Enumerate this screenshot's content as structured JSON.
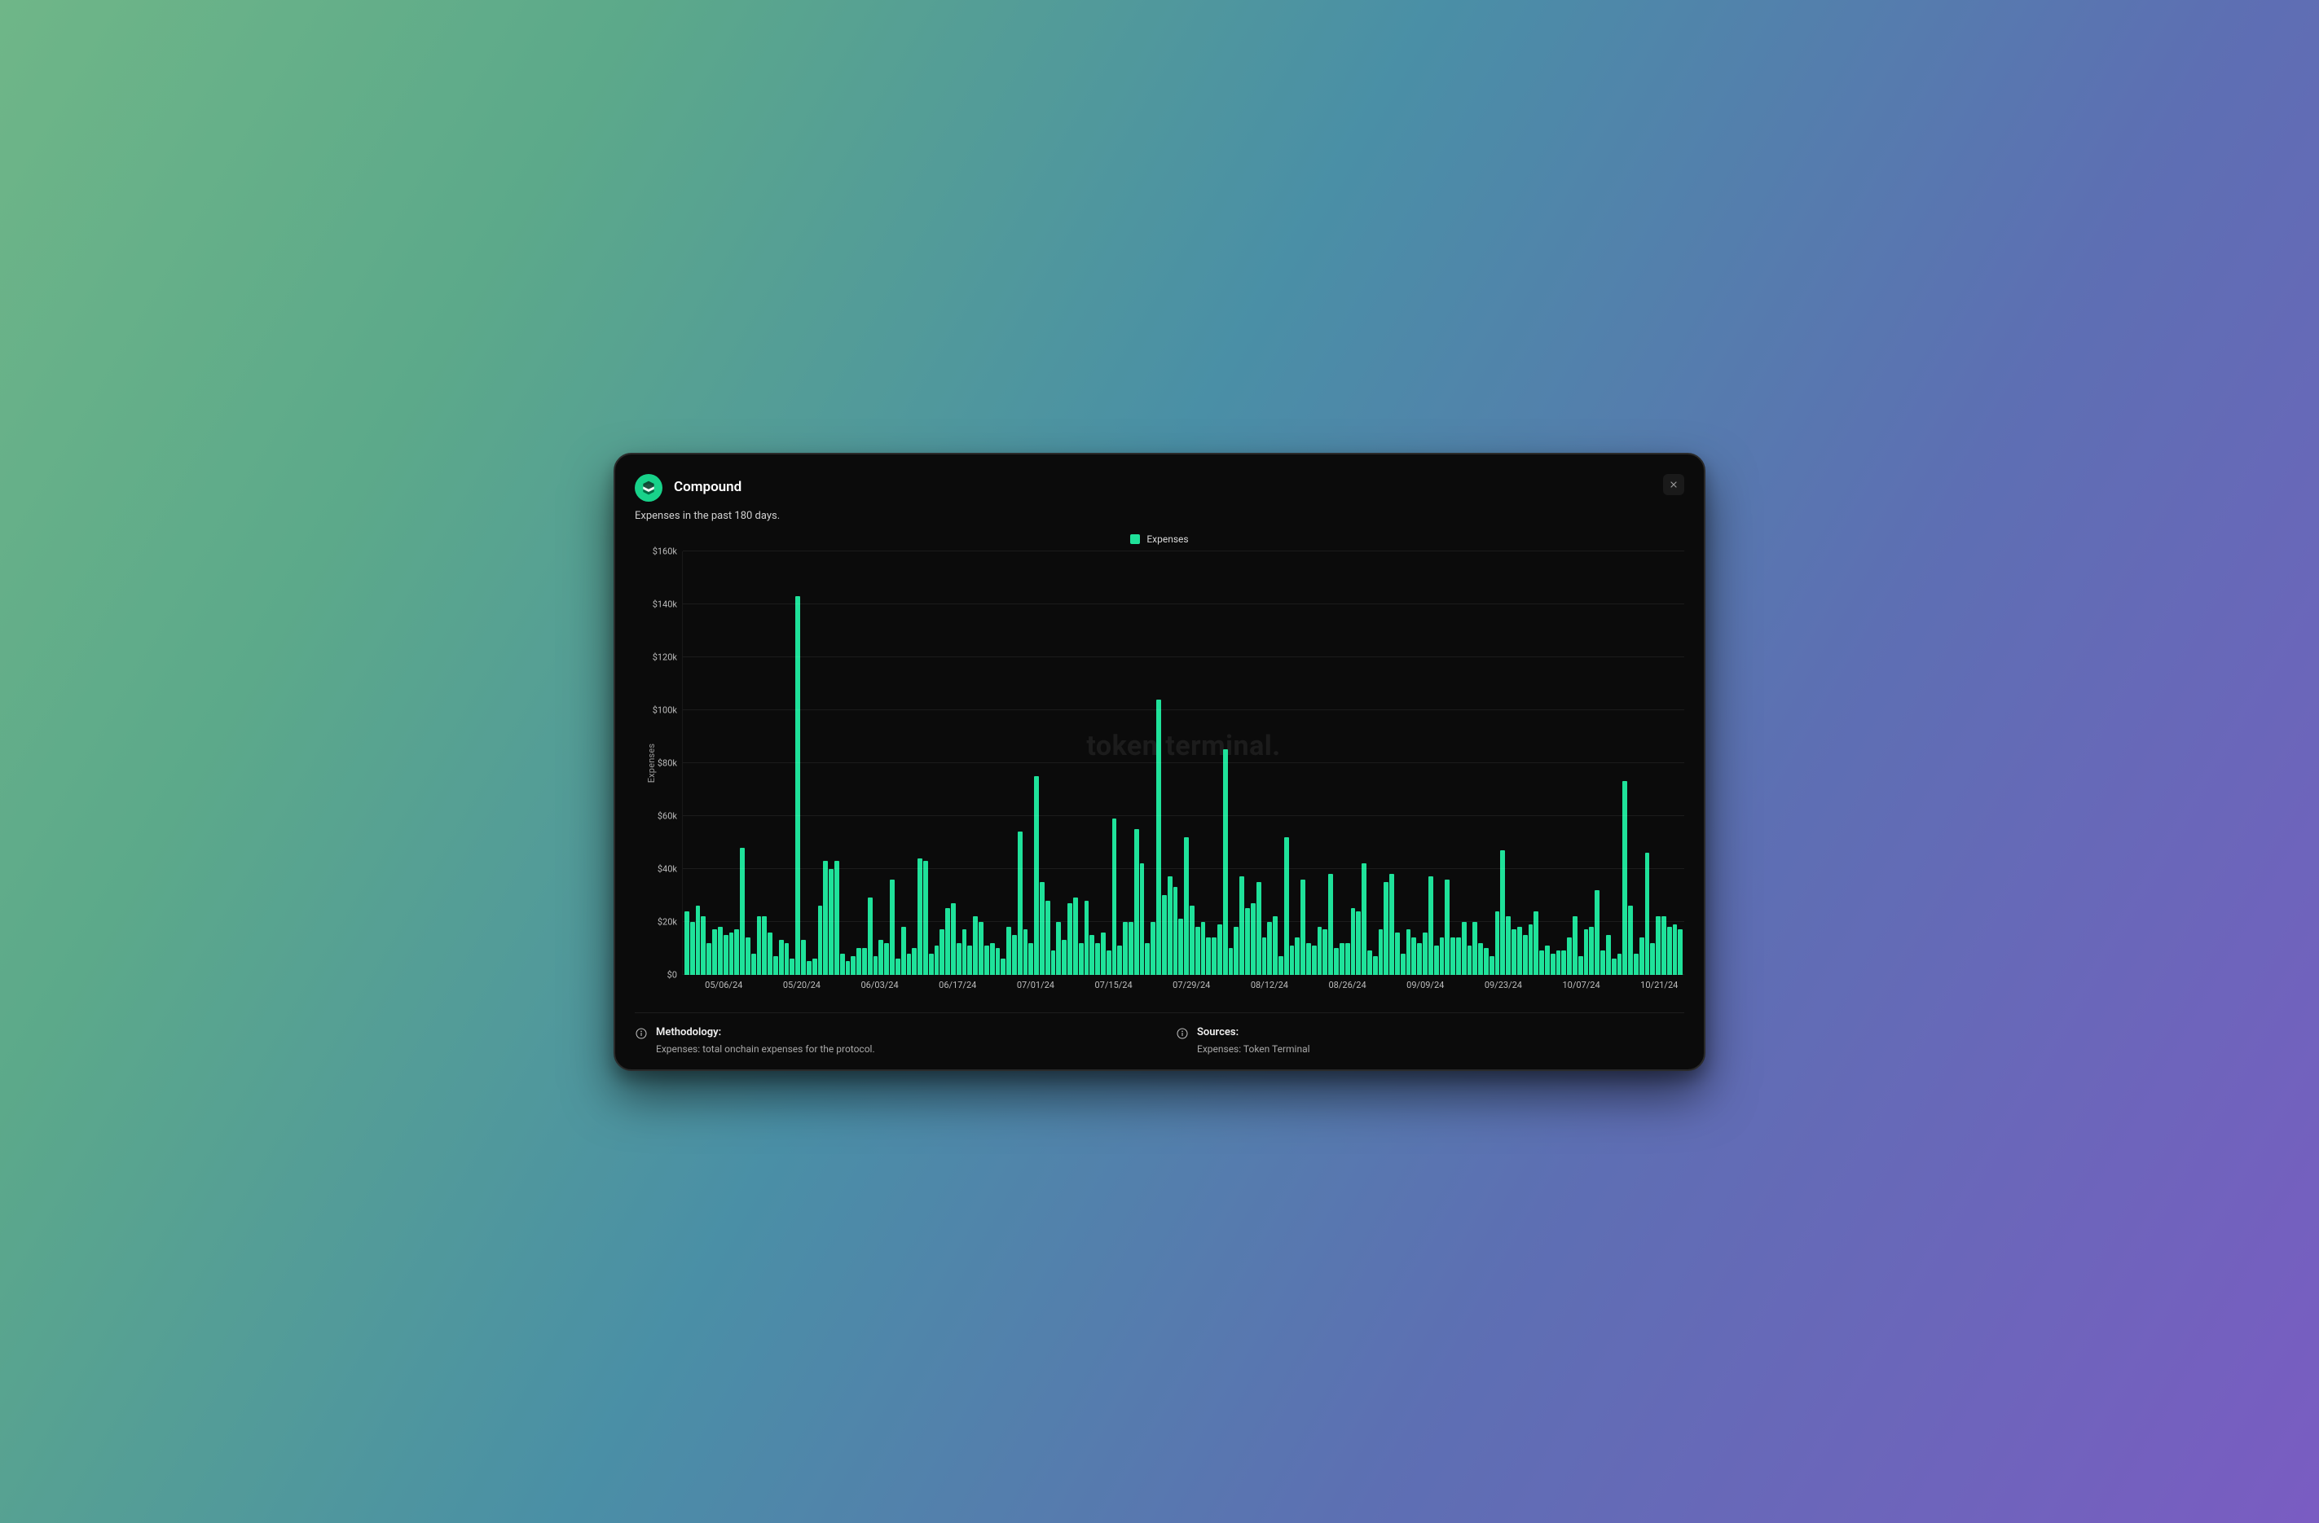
{
  "header": {
    "title": "Compound",
    "subtitle": "Expenses in the past 180 days."
  },
  "legend": {
    "label": "Expenses",
    "color": "#1fe29a"
  },
  "watermark": "token terminal.",
  "ylabel": "Expenses",
  "footer": {
    "methodology_title": "Methodology:",
    "methodology_text": "Expenses: total onchain expenses for the protocol.",
    "sources_title": "Sources:",
    "sources_text": "Expenses: Token Terminal"
  },
  "chart_data": {
    "type": "bar",
    "title": "Compound — Expenses in the past 180 days",
    "xlabel": "",
    "ylabel": "Expenses",
    "ylim": [
      0,
      160000
    ],
    "y_ticks": [
      0,
      20000,
      40000,
      60000,
      80000,
      100000,
      120000,
      140000,
      160000
    ],
    "y_tick_labels": [
      "$0",
      "$20k",
      "$40k",
      "$60k",
      "$80k",
      "$100k",
      "$120k",
      "$140k",
      "$160k"
    ],
    "x_tick_labels": [
      "05/06/24",
      "05/20/24",
      "06/03/24",
      "06/17/24",
      "07/01/24",
      "07/15/24",
      "07/29/24",
      "08/12/24",
      "08/26/24",
      "09/09/24",
      "09/23/24",
      "10/07/24",
      "10/21/24"
    ],
    "legend": [
      "Expenses"
    ],
    "series": [
      {
        "name": "Expenses",
        "color": "#1fe29a",
        "values": [
          24000,
          20000,
          26000,
          22000,
          12000,
          17000,
          18000,
          15000,
          16000,
          17000,
          48000,
          14000,
          8000,
          22000,
          22000,
          16000,
          7000,
          13000,
          12000,
          6000,
          143000,
          13000,
          5000,
          6000,
          26000,
          43000,
          40000,
          43000,
          8000,
          5000,
          7000,
          10000,
          10000,
          29000,
          7000,
          13000,
          12000,
          36000,
          6000,
          18000,
          8000,
          10000,
          44000,
          43000,
          8000,
          11000,
          17000,
          25000,
          27000,
          12000,
          17000,
          11000,
          22000,
          20000,
          11000,
          12000,
          10000,
          6000,
          18000,
          15000,
          54000,
          17000,
          12000,
          75000,
          35000,
          28000,
          9000,
          20000,
          13000,
          27000,
          29000,
          12000,
          28000,
          15000,
          12000,
          16000,
          9000,
          59000,
          11000,
          20000,
          20000,
          55000,
          42000,
          12000,
          20000,
          104000,
          30000,
          37000,
          33000,
          21000,
          52000,
          26000,
          18000,
          20000,
          14000,
          14000,
          19000,
          85000,
          10000,
          18000,
          37000,
          25000,
          27000,
          35000,
          14000,
          20000,
          22000,
          7000,
          52000,
          11000,
          14000,
          36000,
          12000,
          11000,
          18000,
          17000,
          38000,
          10000,
          12000,
          12000,
          25000,
          24000,
          42000,
          9000,
          7000,
          17000,
          35000,
          38000,
          16000,
          8000,
          17000,
          14000,
          12000,
          16000,
          37000,
          11000,
          14000,
          36000,
          14000,
          14000,
          20000,
          11000,
          20000,
          12000,
          10000,
          7000,
          24000,
          47000,
          22000,
          17000,
          18000,
          15000,
          19000,
          24000,
          9000,
          11000,
          8000,
          9000,
          9000,
          14000,
          22000,
          7000,
          17000,
          18000,
          32000,
          9000,
          15000,
          6000,
          8000,
          73000,
          26000,
          8000,
          14000,
          46000,
          12000,
          22000,
          22000,
          18000,
          19000,
          17000
        ]
      }
    ]
  }
}
